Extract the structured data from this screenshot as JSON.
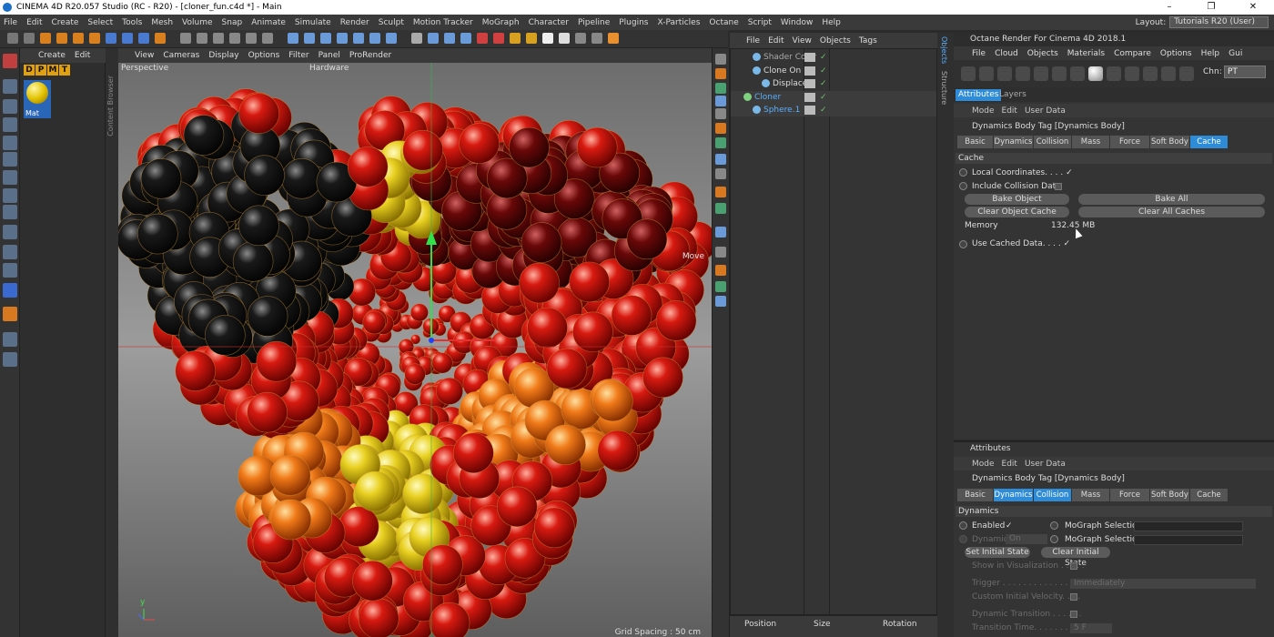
{
  "window": {
    "title": "CINEMA 4D R20.057 Studio (RC - R20) - [cloner_fun.c4d *] - Main"
  },
  "menubar": {
    "items": [
      "File",
      "Edit",
      "Create",
      "Select",
      "Tools",
      "Mesh",
      "Volume",
      "Snap",
      "Animate",
      "Simulate",
      "Render",
      "Sculpt",
      "Motion Tracker",
      "MoGraph",
      "Character",
      "Pipeline",
      "Plugins",
      "X-Particles",
      "Octane",
      "Script",
      "Window",
      "Help"
    ]
  },
  "layout": {
    "label": "Layout:",
    "value": "Tutorials R20 (User)"
  },
  "material_manager": {
    "menu": [
      "Create",
      "Edit"
    ],
    "letters": [
      "D",
      "P",
      "M",
      "T"
    ],
    "material_name": "Mat",
    "vtab": "Content Browser"
  },
  "viewport": {
    "menu": [
      "View",
      "Cameras",
      "Display",
      "Options",
      "Filter",
      "Panel",
      "ProRender"
    ],
    "camera_label": "Perspective",
    "hardware_label": "Hardware",
    "move_label": "Move",
    "grid_spacing": "Grid Spacing : 50 cm"
  },
  "object_manager": {
    "menu": [
      "File",
      "Edit",
      "View",
      "Objects",
      "Tags"
    ],
    "objects": [
      {
        "name": "Shader Color",
        "indent": 1,
        "color": "#aaa"
      },
      {
        "name": "Clone On",
        "indent": 1,
        "color": "#ddd"
      },
      {
        "name": "Displacer",
        "indent": 2,
        "color": "#ddd"
      },
      {
        "name": "Cloner",
        "indent": 0,
        "color": "#5ab0ff"
      },
      {
        "name": "Sphere.1",
        "indent": 1,
        "color": "#5ab0ff"
      }
    ],
    "coords": [
      "Position",
      "Size",
      "Rotation"
    ],
    "vtabs": [
      "Objects",
      "Structure"
    ]
  },
  "octane": {
    "title": "Octane Render For Cinema 4D 2018.1",
    "menu": [
      "File",
      "Cloud",
      "Objects",
      "Materials",
      "Compare",
      "Options",
      "Help",
      "Gui"
    ],
    "chn_label": "Chn:",
    "chn_value": "PT"
  },
  "attributes_top": {
    "tabs": [
      "Attributes",
      "Layers"
    ],
    "menu": [
      "Mode",
      "Edit",
      "User Data"
    ],
    "tag_title": "Dynamics Body Tag [Dynamics Body]",
    "subtabs": [
      "Basic",
      "Dynamics",
      "Collision",
      "Mass",
      "Force",
      "Soft Body",
      "Cache"
    ],
    "active_subtab": "Cache",
    "section": "Cache",
    "local_coords": "Local Coordinates. . . . ✓",
    "include_collision": "Include Collision Data",
    "bake_object": "Bake Object",
    "bake_all": "Bake All",
    "clear_object_cache": "Clear Object Cache",
    "clear_all_caches": "Clear All Caches",
    "memory_label": "Memory",
    "memory_value": "132.45 MB",
    "use_cached": "Use Cached Data. . . . ✓"
  },
  "attributes_bottom": {
    "title": "Attributes",
    "menu": [
      "Mode",
      "Edit",
      "User Data"
    ],
    "tag_title": "Dynamics Body Tag [Dynamics Body]",
    "subtabs": [
      "Basic",
      "Dynamics",
      "Collision",
      "Mass",
      "Force",
      "Soft Body",
      "Cache"
    ],
    "section": "Dynamics",
    "enabled": "Enabled",
    "enabled_check": "✓",
    "mograph_selection": "MoGraph Selection",
    "dynamic_label": "Dynamic",
    "dynamic_value": "On",
    "set_initial_state": "Set Initial State",
    "clear_initial_state": "Clear Initial State",
    "show_in_vis": "Show in Visualization . . . . .",
    "trigger_label": "Trigger . . . . . . . . . . . . . . .",
    "trigger_value": "Immediately",
    "custom_init_vel": "Custom Initial Velocity. . . .",
    "dynamic_transition": "Dynamic Transition . . . . . .",
    "transition_time": "Transition Time. . . . . . . . .",
    "transition_time_value": "5 F"
  },
  "colors": {
    "accent": "#2e8bd8",
    "sphere_black": "#111111",
    "sphere_red": "#c0140c",
    "sphere_orange": "#f07818",
    "sphere_yellow": "#e8d020"
  }
}
